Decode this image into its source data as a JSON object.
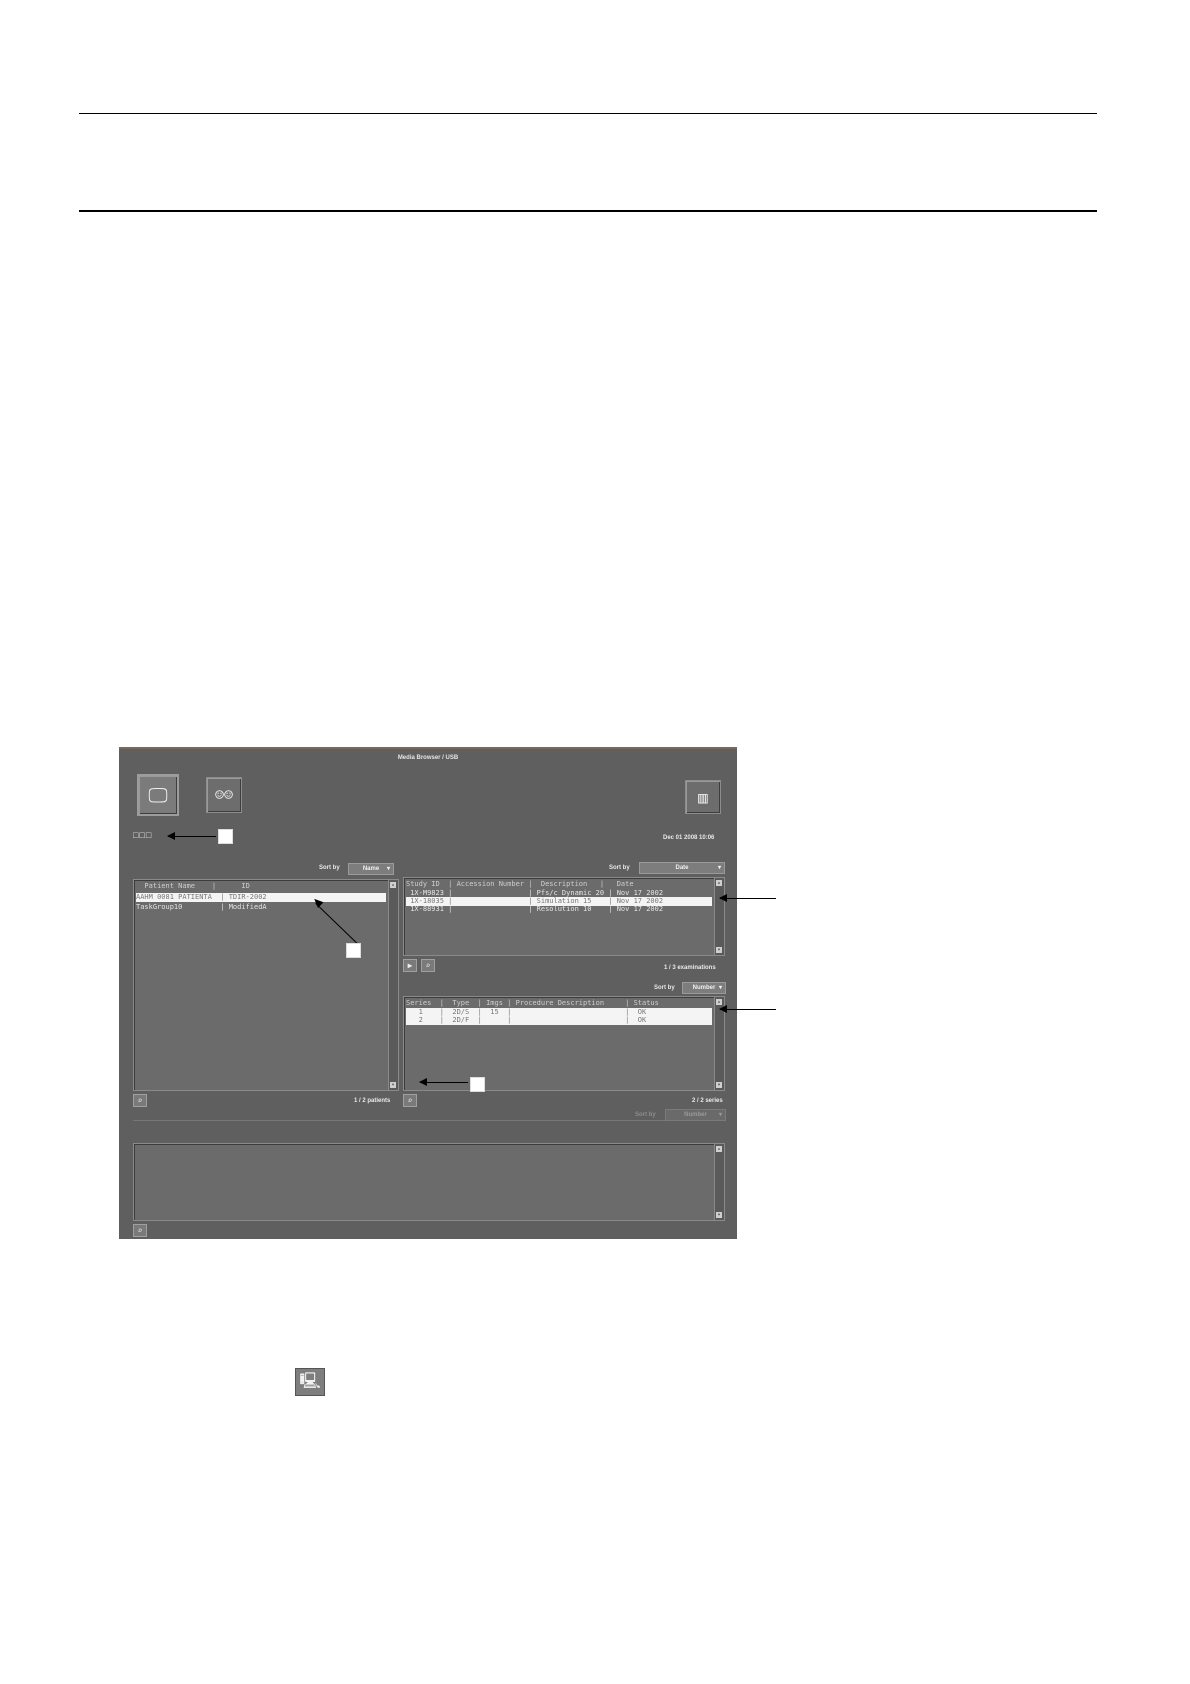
{
  "window": {
    "title": "Media Browser / USB"
  },
  "toolbar": {
    "media_icon": "media-drive-icon",
    "patients_icon": "patients-group-icon",
    "exit_icon": "exit-door-icon",
    "drive_indicators": "□□□",
    "datetime": "Dec 01 2008 10:06"
  },
  "patients": {
    "sort_label": "Sort by",
    "sort_value": "Name",
    "header": "  Patient Name    |      ID",
    "rows": [
      "AAHM 0081 PATIENTA  | TDIR-2002",
      "TaskGroup10         | ModifiedA"
    ],
    "count": "1 / 2 patients"
  },
  "studies": {
    "sort_label": "Sort by",
    "sort_value": "Date",
    "header": "Study ID  | Accession Number |  Description   |   Date",
    "rows": [
      " 1X-M9823 |                  | Pfs/c Dynamic 20 | Nov 17 2002",
      " 1X-18035 |                  | Simulation 15    | Nov 17 2002",
      " 1X-88931 |                  | Resolution 10    | Nov 17 2002"
    ],
    "count": "1 / 3 examinations"
  },
  "series": {
    "sort_label": "Sort by",
    "sort_value": "Number",
    "header": "Series  |  Type  | Imgs | Procedure Description     | Status",
    "rows": [
      "   1    |  2D/S  |  15  |                           |  OK",
      "   2    |  2D/F  |      |                           |  OK"
    ],
    "count": "2 / 2 series"
  },
  "images": {
    "sort_label": "Sort by",
    "sort_value": "Number"
  },
  "footer_icon": "media-export-icon"
}
